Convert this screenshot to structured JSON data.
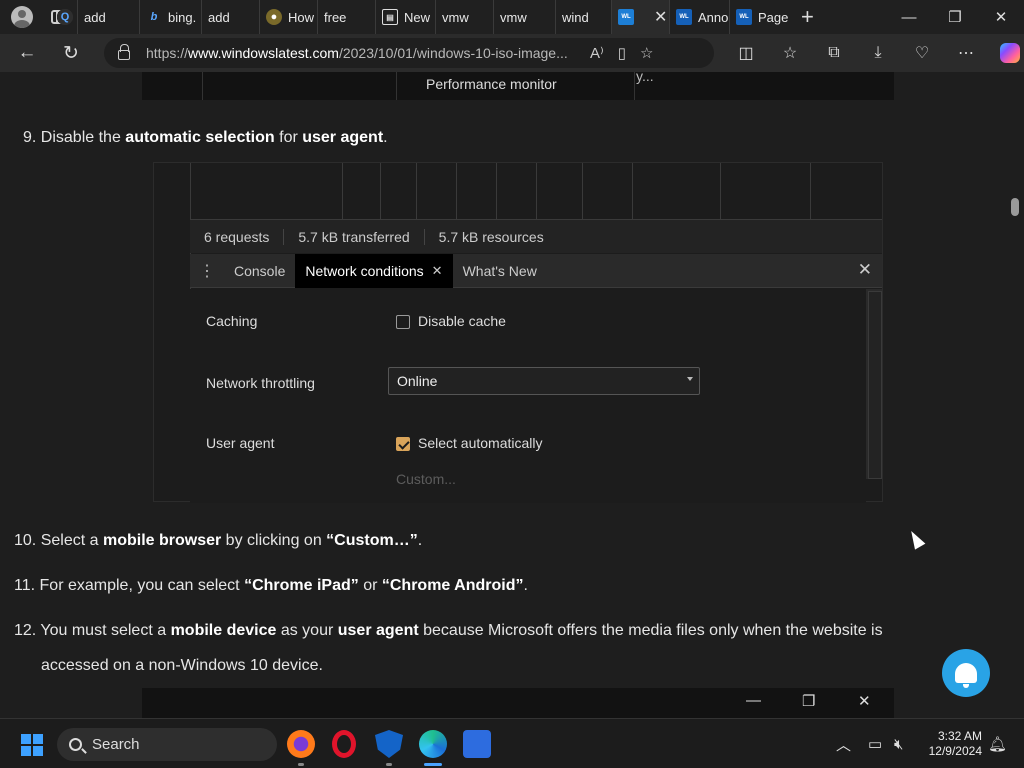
{
  "browser": {
    "tabs": [
      {
        "label": "add",
        "icon": "search-icon"
      },
      {
        "label": "bing.",
        "icon": "bing-icon"
      },
      {
        "label": "add",
        "icon": "search-icon"
      },
      {
        "label": "How",
        "icon": "how-icon"
      },
      {
        "label": "free",
        "icon": "search-icon"
      },
      {
        "label": "New",
        "icon": "news-icon"
      },
      {
        "label": "vmw",
        "icon": "search-icon"
      },
      {
        "label": "vmw",
        "icon": "search-icon"
      },
      {
        "label": "wind",
        "icon": "search-icon"
      },
      {
        "label": "",
        "icon": "windowslatest-icon",
        "active": true
      },
      {
        "label": "Anno",
        "icon": "windowslatest-icon"
      },
      {
        "label": "Page",
        "icon": "windowslatest-icon"
      }
    ],
    "url_prefix": "https://",
    "url_host": "www.windowslatest.com",
    "url_path": "/2023/10/01/windows-10-iso-image..."
  },
  "article": {
    "top_cell_text": "Performance monitor",
    "top_cell_dots": "y...",
    "step9": {
      "num": "9.",
      "pre": "Disable the ",
      "b1": "automatic selection",
      "mid": " for ",
      "b2": "user agent",
      "post": "."
    },
    "step10": {
      "num": "10.",
      "pre": "Select a ",
      "b1": "mobile browser",
      "mid": " by clicking on ",
      "b2": "“Custom…”",
      "post": "."
    },
    "step11": {
      "num": "11.",
      "pre": "For example, you can select ",
      "b1": "“Chrome iPad”",
      "mid": " or ",
      "b2": "“Chrome Android”",
      "post": "."
    },
    "step12": {
      "num": "12.",
      "pre": "You must select a ",
      "b1": "mobile device",
      "mid": " as your ",
      "b2": "user agent",
      "post": " because Microsoft offers the media files only when the website is",
      "line2": "accessed on a non-Windows 10 device."
    }
  },
  "devtools": {
    "stats": [
      "6 requests",
      "5.7 kB transferred",
      "5.7 kB resources"
    ],
    "tabs": {
      "console": "Console",
      "network_conditions": "Network conditions",
      "whats_new": "What's New"
    },
    "caching_label": "Caching",
    "disable_cache_label": "Disable cache",
    "throttling_label": "Network throttling",
    "throttling_value": "Online",
    "user_agent_label": "User agent",
    "select_auto_label": "Select automatically",
    "custom_placeholder": "Custom..."
  },
  "taskbar": {
    "search_label": "Search",
    "time": "3:32 AM",
    "date": "12/9/2024"
  },
  "colors": {
    "accent_checkbox": "#d9a45a",
    "bell": "#29a3e6",
    "start": "#3da1ff"
  }
}
